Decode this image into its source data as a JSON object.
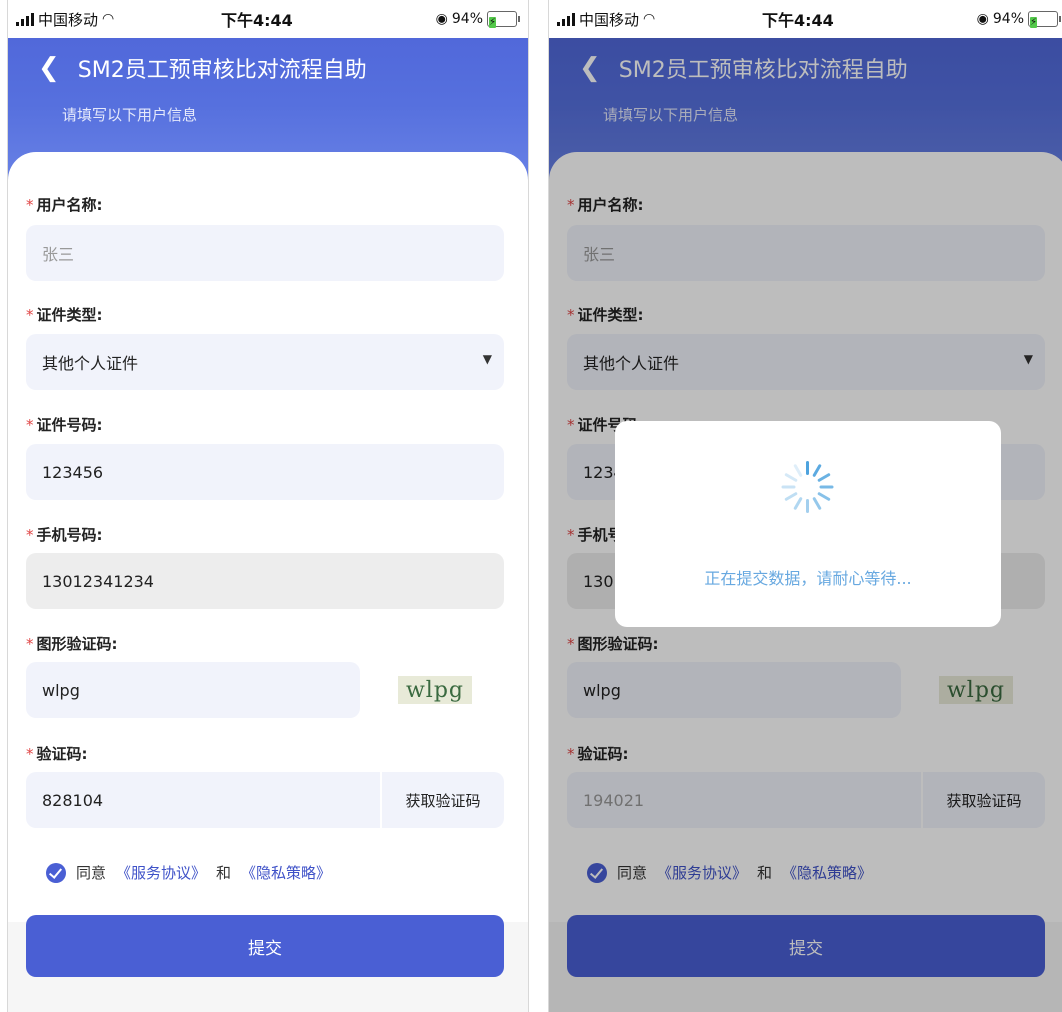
{
  "status": {
    "carrier": "中国移动",
    "time": "下午4:44",
    "battery": "94%"
  },
  "nav": {
    "title": "SM2员工预审核比对流程自助",
    "subtitle": "请填写以下用户信息"
  },
  "form": {
    "required_mark": "*",
    "username_label": "用户名称:",
    "username_value": "张三",
    "idtype_label": "证件类型:",
    "idtype_value": "其他个人证件",
    "idnumber_label": "证件号码:",
    "idnumber_value": "123456",
    "phone_label": "手机号码:",
    "phone_value": "13012341234",
    "captcha_label": "图形验证码:",
    "captcha_value": "wlpg",
    "captcha_image_text": "wlpg",
    "code_label": "验证码:",
    "get_code_button": "获取验证码",
    "agree_text": "同意",
    "agree_link1": "《服务协议》",
    "agree_and": "和",
    "agree_link2": "《隐私策略》",
    "submit": "提交"
  },
  "left": {
    "code_value": "828104"
  },
  "right": {
    "code_value": "194021",
    "loading_message": "正在提交数据，请耐心等待..."
  },
  "colors": {
    "primary": "#4a5fd4",
    "header": "#5670de",
    "required": "#e04646",
    "link": "#3f52c8",
    "spinner": "#4ea3de"
  },
  "icons": [
    "back-chevron-icon",
    "signal-bars-icon",
    "wifi-icon",
    "battery-icon",
    "orientation-lock-icon",
    "dropdown-caret-icon",
    "check-circle-icon",
    "loading-spinner-icon"
  ]
}
